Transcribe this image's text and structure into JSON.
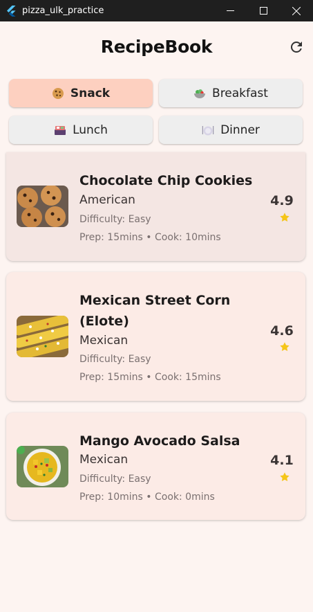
{
  "window": {
    "title": "pizza_ulk_practice",
    "controls": [
      "minimize-icon",
      "maximize-icon",
      "close-icon"
    ]
  },
  "header": {
    "title": "RecipeBook",
    "refresh_icon": "refresh-icon"
  },
  "categories": [
    {
      "label": "Snack",
      "icon": "cookie-icon",
      "selected": true
    },
    {
      "label": "Breakfast",
      "icon": "salad-bowl-icon",
      "selected": false
    },
    {
      "label": "Lunch",
      "icon": "bento-box-icon",
      "selected": false
    },
    {
      "label": "Dinner",
      "icon": "plate-icon",
      "selected": false
    }
  ],
  "recipes": [
    {
      "name": "Chocolate Chip Cookies",
      "cuisine": "American",
      "difficulty": "Difficulty: Easy",
      "time": "Prep: 15mins • Cook: 10mins",
      "rating": "4.9"
    },
    {
      "name": "Mexican Street Corn (Elote)",
      "cuisine": "Mexican",
      "difficulty": "Difficulty: Easy",
      "time": "Prep: 15mins • Cook: 15mins",
      "rating": "4.6"
    },
    {
      "name": "Mango Avocado Salsa",
      "cuisine": "Mexican",
      "difficulty": "Difficulty: Easy",
      "time": "Prep: 10mins • Cook: 0mins",
      "rating": "4.1"
    }
  ],
  "colors": {
    "selected_chip": "#fdd0c0",
    "chip": "#eeeeee",
    "card": "#fcebe6",
    "star": "#f5c518",
    "background": "#fdf4f1"
  }
}
